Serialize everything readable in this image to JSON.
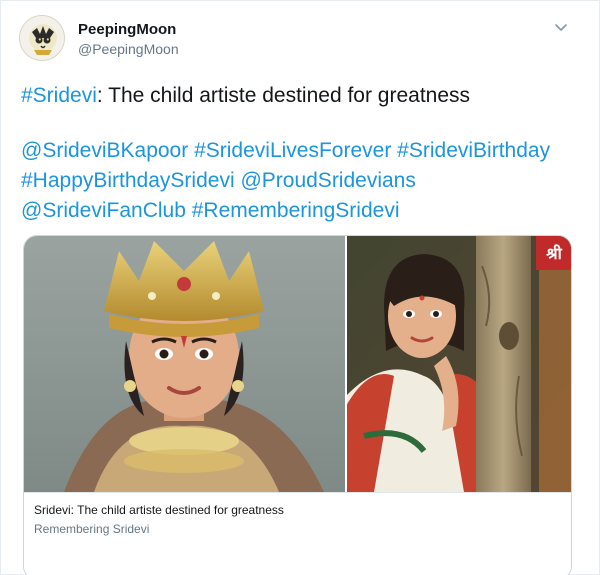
{
  "user": {
    "display_name": "PeepingMoon",
    "handle": "@PeepingMoon"
  },
  "tweet": {
    "headline_tag": "#Sridevi",
    "headline_text": ": The child artiste destined for greatness",
    "tags": [
      "@SrideviBKapoor",
      "#SrideviLivesForever",
      "#SrideviBirthday",
      "#HappyBirthdaySridevi",
      "@ProudSridevians",
      "@SrideviFanClub",
      "#RememberingSridevi"
    ]
  },
  "card": {
    "title": "Sridevi: The child artiste destined for greatness",
    "domain": "Remembering Sridevi",
    "images": [
      "child-artiste-crown-photo",
      "saree-tree-photo"
    ],
    "overlay_logo_text": "श्री"
  },
  "icons": {
    "avatar": "peepingmoon-logo-icon",
    "more": "chevron-down-icon"
  },
  "colors": {
    "link": "#1b95e0",
    "text": "#14171a",
    "secondary": "#657786",
    "border": "#ccd6dd"
  }
}
